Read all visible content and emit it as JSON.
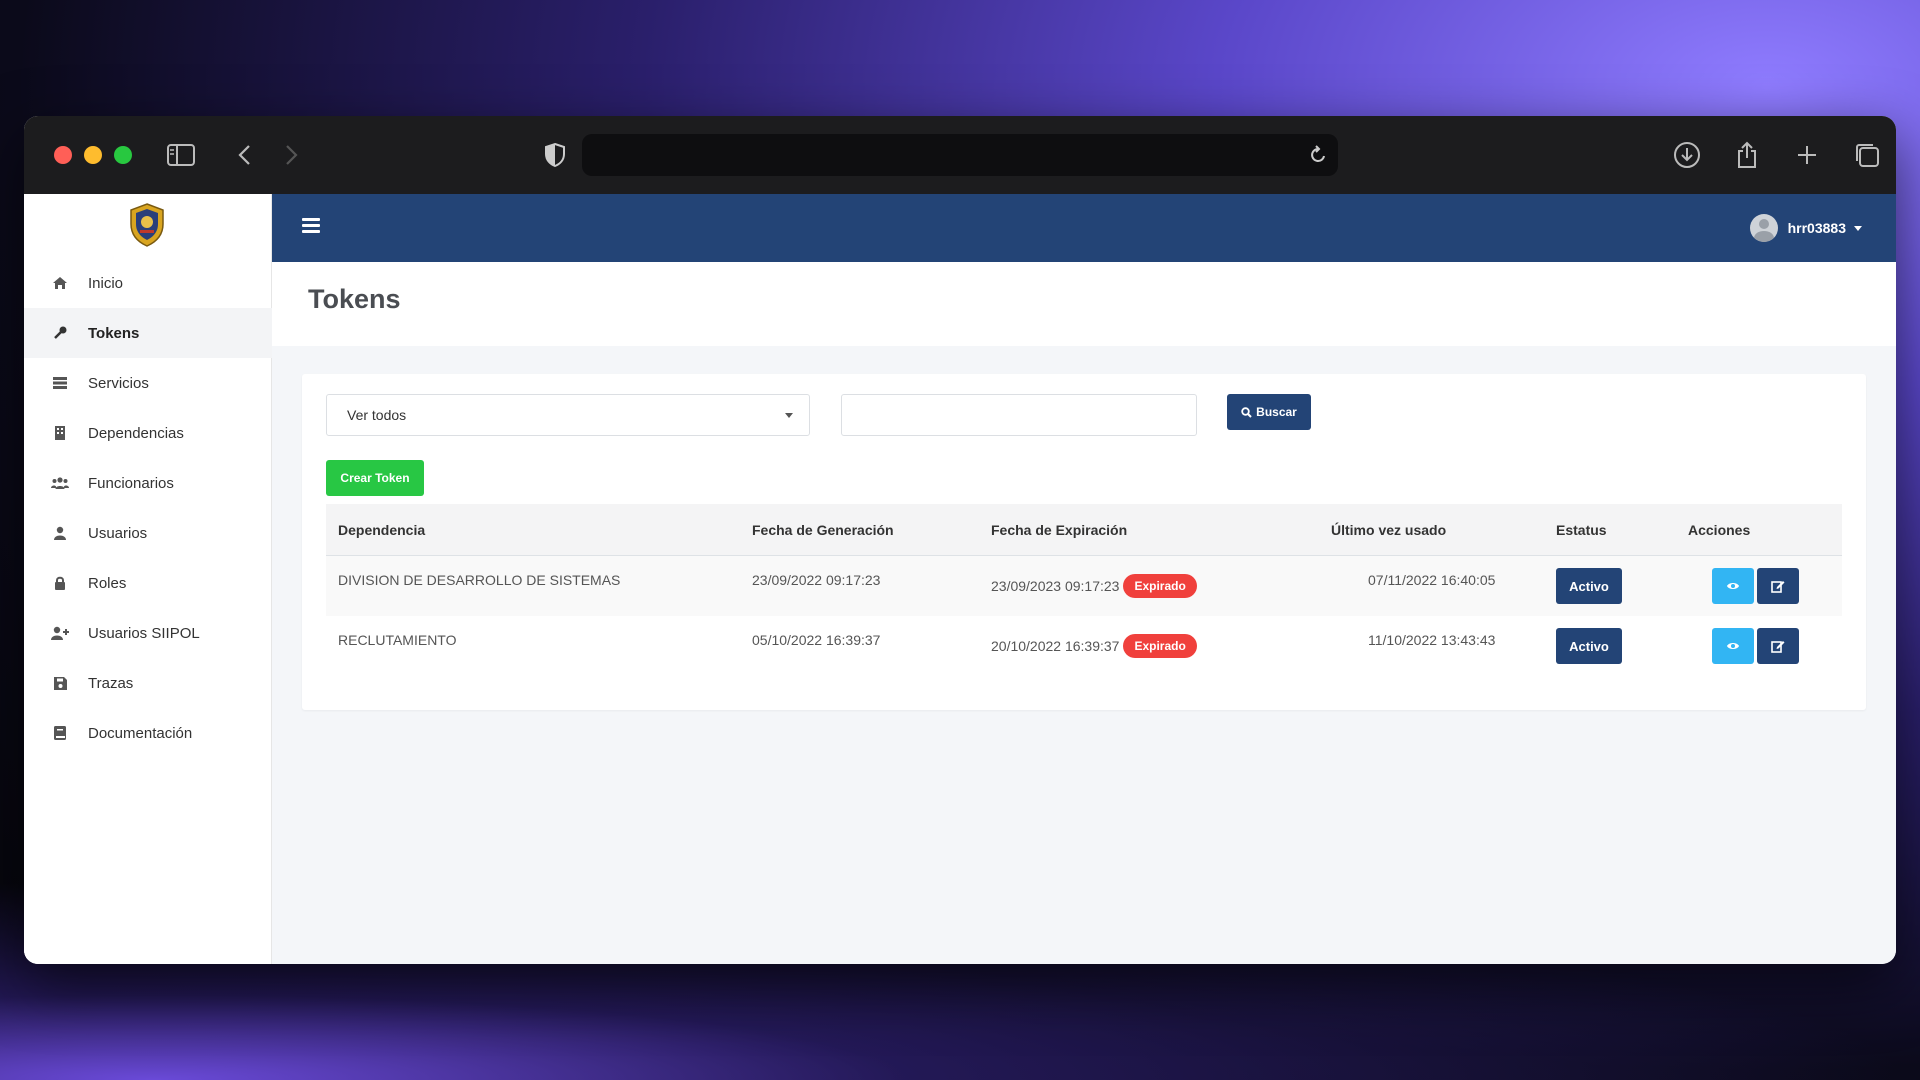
{
  "browser": {
    "url": ""
  },
  "sidebar": {
    "items": [
      {
        "label": "Inicio",
        "icon": "home-icon"
      },
      {
        "label": "Tokens",
        "icon": "key-icon",
        "active": true
      },
      {
        "label": "Servicios",
        "icon": "server-icon"
      },
      {
        "label": "Dependencias",
        "icon": "building-icon"
      },
      {
        "label": "Funcionarios",
        "icon": "users-icon"
      },
      {
        "label": "Usuarios",
        "icon": "user-icon"
      },
      {
        "label": "Roles",
        "icon": "lock-icon"
      },
      {
        "label": "Usuarios SIIPOL",
        "icon": "user-plus-icon"
      },
      {
        "label": "Trazas",
        "icon": "save-icon"
      },
      {
        "label": "Documentación",
        "icon": "book-icon"
      }
    ]
  },
  "topbar": {
    "username": "hrr03883"
  },
  "page": {
    "title": "Tokens"
  },
  "filters": {
    "select_value": "Ver todos",
    "search_value": "",
    "search_button": "Buscar",
    "create_button": "Crear Token"
  },
  "table": {
    "headers": {
      "dependencia": "Dependencia",
      "fecha_generacion": "Fecha de Generación",
      "fecha_expiracion": "Fecha de Expiración",
      "ultimo_uso": "Último vez usado",
      "estatus": "Estatus",
      "acciones": "Acciones"
    },
    "rows": [
      {
        "dependencia": "DIVISION DE DESARROLLO DE SISTEMAS",
        "fecha_generacion": "23/09/2022 09:17:23",
        "fecha_expiracion": "23/09/2023 09:17:23",
        "expiracion_badge": "Expirado",
        "ultimo_uso": "07/11/2022 16:40:05",
        "estatus": "Activo"
      },
      {
        "dependencia": "RECLUTAMIENTO",
        "fecha_generacion": "05/10/2022 16:39:37",
        "fecha_expiracion": "20/10/2022 16:39:37",
        "expiracion_badge": "Expirado",
        "ultimo_uso": "11/10/2022 13:43:43",
        "estatus": "Activo"
      }
    ]
  },
  "colors": {
    "primary": "#234476",
    "success": "#28c744",
    "danger": "#f0403c",
    "info": "#32b5f3"
  }
}
